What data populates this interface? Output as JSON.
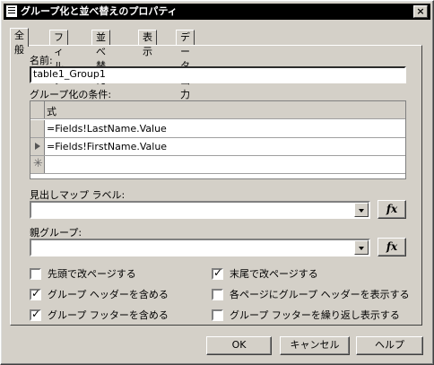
{
  "window": {
    "title": "グループ化と並べ替えのプロパティ",
    "close_glyph": "×"
  },
  "tabs": [
    "全般",
    "フィルタ",
    "並べ替え",
    "表示",
    "データ出力"
  ],
  "general": {
    "name_label": "名前:",
    "name_value": "table1_Group1",
    "group_label": "グループ化の条件:",
    "grid_header": "式",
    "grid_rows": [
      "=Fields!LastName.Value",
      "=Fields!FirstName.Value"
    ],
    "new_row_glyph": "✳",
    "doc_map_label": "見出しマップ ラベル:",
    "doc_map_value": "",
    "parent_group_label": "親グループ:",
    "parent_group_value": "",
    "fx_label": "fx",
    "checkboxes_left": [
      {
        "label": "先頭で改ページする",
        "checked": false
      },
      {
        "label": "グループ ヘッダーを含める",
        "checked": true
      },
      {
        "label": "グループ フッターを含める",
        "checked": true
      }
    ],
    "checkboxes_right": [
      {
        "label": "末尾で改ページする",
        "checked": true
      },
      {
        "label": "各ページにグループ ヘッダーを表示する",
        "checked": false
      },
      {
        "label": "グループ フッターを繰り返し表示する",
        "checked": false
      }
    ]
  },
  "buttons": {
    "ok": "OK",
    "cancel": "キャンセル",
    "help": "ヘルプ"
  }
}
